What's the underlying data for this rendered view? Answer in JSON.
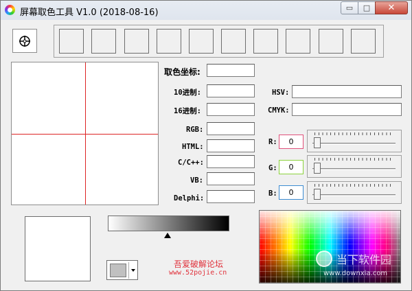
{
  "window": {
    "title": "屏幕取色工具 V1.0    (2018-08-16)",
    "controls": {
      "minimize": "▭",
      "maximize": "□",
      "close": "✕"
    }
  },
  "palette": {
    "swatch_count": 10
  },
  "labels": {
    "pick_coord": "取色坐标:",
    "dec": "10进制:",
    "hex": "16进制:",
    "rgb": "RGB:",
    "html": "HTML:",
    "c_cpp": "C/C++:",
    "vb": "VB:",
    "delphi": "Delphi:",
    "hsv": "HSV:",
    "cmyk": "CMYK:",
    "r": "R:",
    "g": "G:",
    "b": "B:"
  },
  "values": {
    "pick_coord": "",
    "dec": "",
    "hex": "",
    "rgb": "",
    "html": "",
    "c_cpp": "",
    "vb": "",
    "delphi": "",
    "hsv": "",
    "cmyk": "",
    "r": "0",
    "g": "0",
    "b": "0"
  },
  "colors": {
    "r_border": "#e0507a",
    "g_border": "#8cd23c",
    "b_border": "#3c8cd2",
    "crosshair": "#dd2222",
    "dropdown_selected": "#c0c0c0"
  },
  "credit": {
    "name": "吾爱破解论坛",
    "url": "www.52pojie.cn"
  },
  "watermark": {
    "brand": "当下软件园",
    "url": "www.downxia.com"
  }
}
